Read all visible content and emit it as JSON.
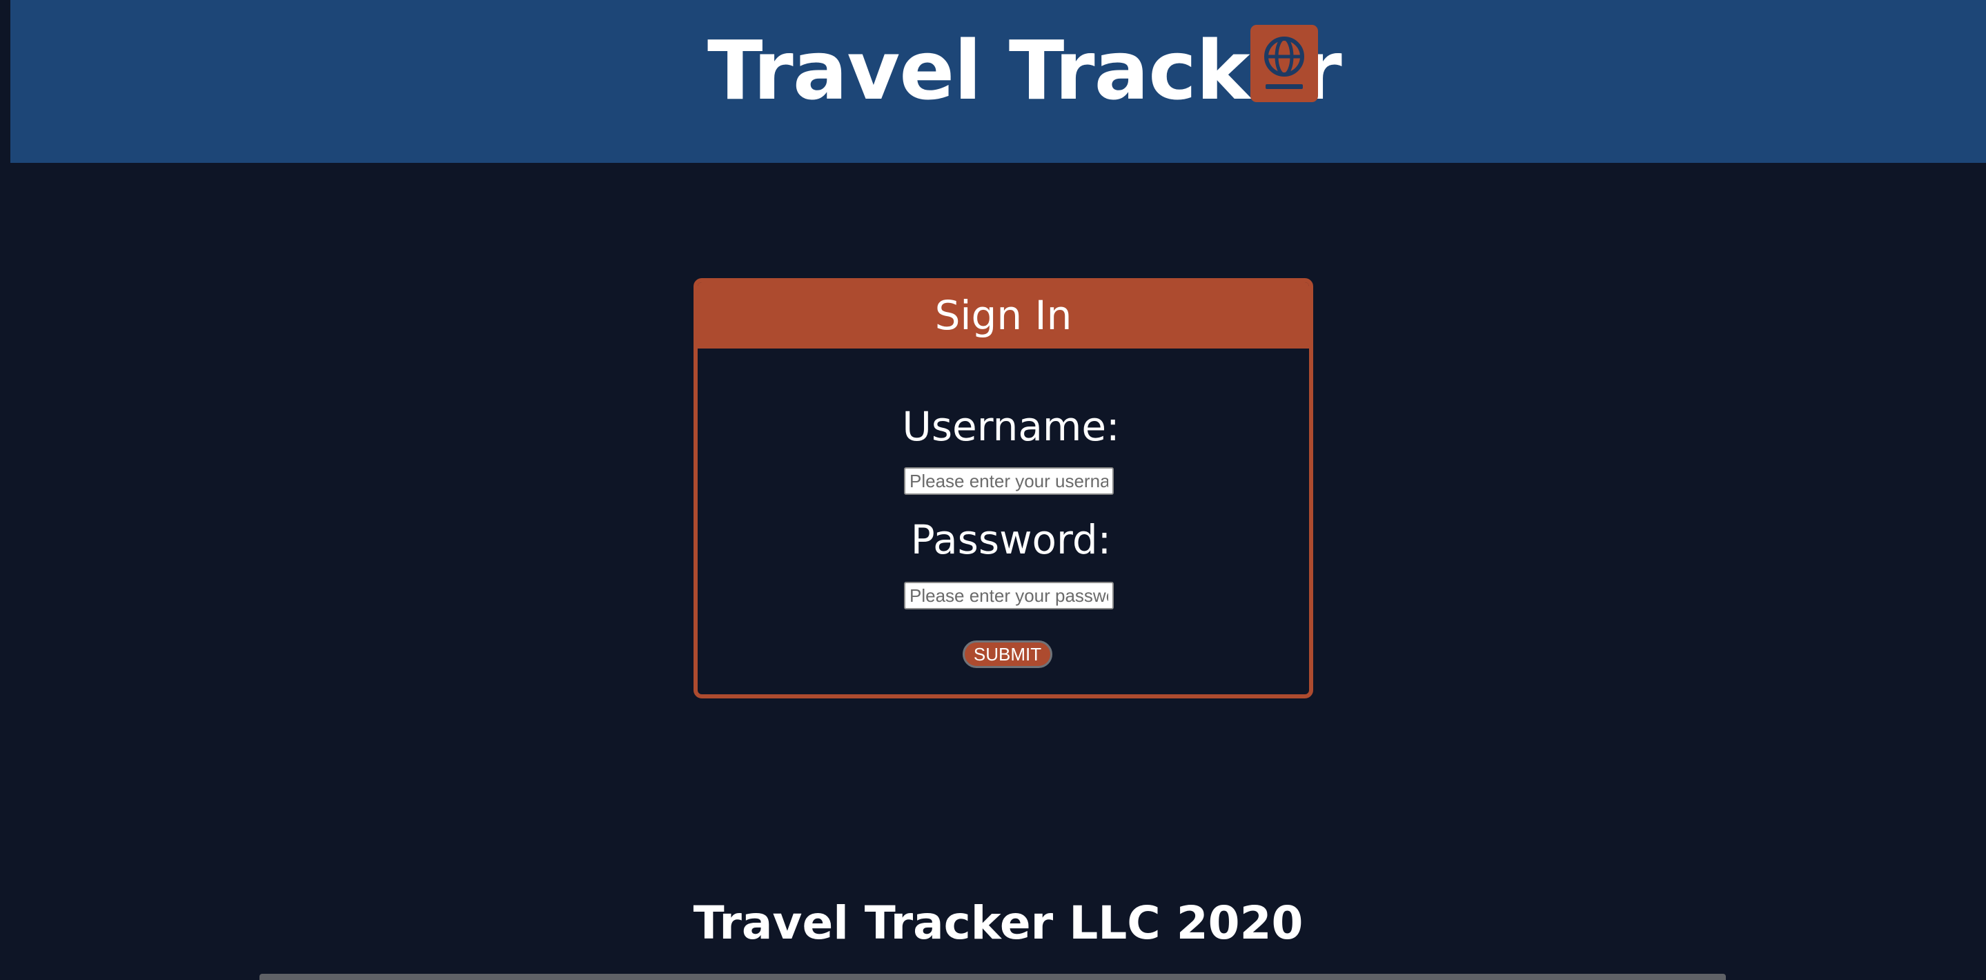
{
  "header": {
    "title": "Travel Tracker",
    "icon": "passport-icon"
  },
  "signin": {
    "heading": "Sign In",
    "username_label": "Username:",
    "username_placeholder": "Please enter your username",
    "username_value": "",
    "password_label": "Password:",
    "password_placeholder": "Please enter your password",
    "password_value": "",
    "submit_label": "SUBMIT"
  },
  "footer": {
    "text": "Travel Tracker LLC 2020"
  },
  "colors": {
    "header_bg": "#1d4677",
    "page_bg": "#0e1526",
    "accent": "#ad4b2f",
    "text": "#ffffff"
  }
}
